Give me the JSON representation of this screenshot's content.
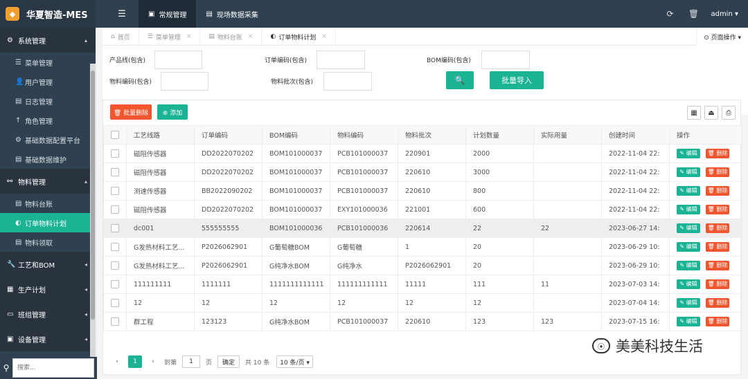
{
  "app": {
    "title": "华夏智造-MES",
    "logo_glyph": "◆"
  },
  "topnav": {
    "menu_icon": "☰",
    "items": [
      {
        "icon": "▣",
        "label": "常规管理"
      },
      {
        "icon": "▤",
        "label": "现场数据采集"
      }
    ]
  },
  "topright": {
    "refresh_icon": "⟳",
    "clear_icon": "🗑",
    "user": "admin ▾"
  },
  "sidebar": {
    "sections": [
      {
        "icon": "⚙",
        "label": "系统管理",
        "caret": "▴",
        "items": [
          {
            "icon": "☰",
            "label": "菜单管理"
          },
          {
            "icon": "👤",
            "label": "用户管理"
          },
          {
            "icon": "▤",
            "label": "日志管理"
          },
          {
            "icon": "↑",
            "label": "角色管理"
          },
          {
            "icon": "⚙",
            "label": "基础数据配置平台"
          },
          {
            "icon": "▤",
            "label": "基础数据维护"
          }
        ]
      },
      {
        "icon": "⚯",
        "label": "物料管理",
        "caret": "▴",
        "items": [
          {
            "icon": "▤",
            "label": "物料台账"
          },
          {
            "icon": "◐",
            "label": "订单物料计划"
          },
          {
            "icon": "▤",
            "label": "物料领取"
          }
        ]
      },
      {
        "icon": "🔧",
        "label": "工艺和BOM",
        "caret": "◂"
      },
      {
        "icon": "▦",
        "label": "生产计划",
        "caret": "◂"
      },
      {
        "icon": "▭",
        "label": "班组管理",
        "caret": "◂"
      },
      {
        "icon": "▣",
        "label": "设备管理",
        "caret": "◂"
      }
    ],
    "search_placeholder": "搜索..."
  },
  "tabs": [
    {
      "icon": "⌂",
      "label": "首页",
      "close": ""
    },
    {
      "icon": "☰",
      "label": "菜单管理",
      "close": "×"
    },
    {
      "icon": "▤",
      "label": "物料台账",
      "close": "×"
    },
    {
      "icon": "◐",
      "label": "订单物料计划",
      "close": "×"
    }
  ],
  "page_ops": "⊙ 页面操作 ▾",
  "filters": {
    "product_line": "产品线(包含)",
    "order_code": "订单编码(包含)",
    "bom_code": "BOM编码(包含)",
    "material_code": "物料编码(包含)",
    "material_batch": "物料批次(包含)",
    "search_icon": "🔍",
    "import_label": "批量导入"
  },
  "toolbar": {
    "batch_delete": "🗑 批量删除",
    "add": "⊕ 添加",
    "tool_icons": [
      "▦",
      "⏏",
      "⎙"
    ]
  },
  "table": {
    "headers": [
      "工艺线路",
      "订单编码",
      "BOM编码",
      "物料编码",
      "物料批次",
      "计划数量",
      "实际用量",
      "创建时间",
      "操作"
    ],
    "rows": [
      [
        "磁阻传感器",
        "DD2022070202",
        "BOM101000037",
        "PCB101000037",
        "220901",
        "2000",
        "",
        "2022-11-04 22:"
      ],
      [
        "磁阻传感器",
        "DD2022070202",
        "BOM101000037",
        "PCB101000037",
        "220610",
        "3000",
        "",
        "2022-11-04 22:"
      ],
      [
        "测速传感器",
        "BB2022090202",
        "BOM101000037",
        "PCB101000037",
        "220610",
        "800",
        "",
        "2022-11-04 22:"
      ],
      [
        "磁阻传感器",
        "DD2022070202",
        "BOM101000037",
        "EXY101000036",
        "221001",
        "600",
        "",
        "2022-11-04 22:"
      ],
      [
        "dc001",
        "555555555",
        "BOM101000036",
        "PCB101000036",
        "220614",
        "22",
        "22",
        "2023-06-27 14:"
      ],
      [
        "G发热材料工艺...",
        "P2026062901",
        "G葡萄糖BOM",
        "G葡萄糖",
        "1",
        "20",
        "",
        "2023-06-29 10:"
      ],
      [
        "G发热材料工艺...",
        "P2026062901",
        "G纯净水BOM",
        "G纯净水",
        "P2026062901",
        "20",
        "",
        "2023-06-29 10:"
      ],
      [
        "111111111",
        "1111111",
        "1111111111111",
        "111111111111",
        "11111",
        "111",
        "11",
        "2023-07-03 14:"
      ],
      [
        "12",
        "12",
        "12",
        "12",
        "12",
        "12",
        "",
        "2023-07-04 14:"
      ],
      [
        "群工程",
        "123123",
        "G纯净水BOM",
        "PCB101000037",
        "220610",
        "123",
        "123",
        "2023-07-15 16:"
      ]
    ],
    "edit_label": "✎ 编辑",
    "delete_label": "🗑 删除"
  },
  "pager": {
    "prev": "‹",
    "current": "1",
    "next": "›",
    "goto": "到第",
    "page_value": "1",
    "page_unit": "页",
    "confirm": "确定",
    "total": "共 10 条",
    "per_page": "10 条/页 ▾"
  },
  "watermark": "美美科技生活"
}
